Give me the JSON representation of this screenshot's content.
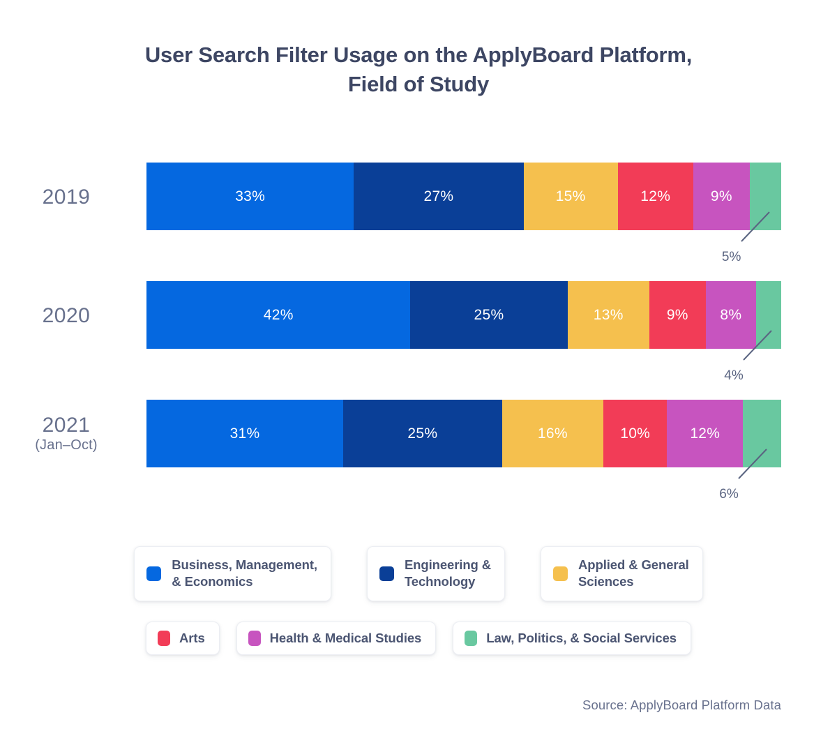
{
  "title": "User Search Filter Usage on the ApplyBoard Platform,\nField of Study",
  "source": "Source: ApplyBoard Platform Data",
  "colors": {
    "business": "#0568e0",
    "engineering": "#0a3f97",
    "sciences": "#f5c04e",
    "arts": "#f23c57",
    "health": "#c754bf",
    "law": "#69c8a0",
    "title_text": "#3d4663",
    "label_text": "#68718d",
    "legend_text": "#4b5572",
    "source_text": "#69728e",
    "card_border": "#eceef3",
    "background": "#ffffff"
  },
  "chart_data": {
    "type": "bar",
    "orientation": "horizontal",
    "stacked": true,
    "normalized_percent": true,
    "title": "User Search Filter Usage on the ApplyBoard Platform, Field of Study",
    "xlabel": "",
    "ylabel": "",
    "xlim": [
      0,
      101
    ],
    "grid": false,
    "legend_position": "bottom",
    "categories": [
      "2019",
      "2020",
      "2021 (Jan–Oct)"
    ],
    "series": [
      {
        "name": "Business, Management, & Economics",
        "color": "#0568e0",
        "values": [
          33,
          42,
          31
        ]
      },
      {
        "name": "Engineering & Technology",
        "color": "#0a3f97",
        "values": [
          27,
          25,
          25
        ]
      },
      {
        "name": "Applied & General Sciences",
        "color": "#f5c04e",
        "values": [
          15,
          13,
          16
        ]
      },
      {
        "name": "Arts",
        "color": "#f23c57",
        "values": [
          12,
          9,
          10
        ]
      },
      {
        "name": "Health & Medical Studies",
        "color": "#c754bf",
        "values": [
          9,
          8,
          12
        ]
      },
      {
        "name": "Law, Politics, & Social Services",
        "color": "#69c8a0",
        "values": [
          5,
          4,
          6
        ]
      }
    ],
    "annotations": [
      {
        "text": "5%",
        "series": "Law, Politics, & Social Services",
        "category": "2019",
        "style": "leader-line-outside"
      },
      {
        "text": "4%",
        "series": "Law, Politics, & Social Services",
        "category": "2020",
        "style": "leader-line-outside"
      },
      {
        "text": "6%",
        "series": "Law, Politics, & Social Services",
        "category": "2021 (Jan–Oct)",
        "style": "leader-line-outside"
      }
    ]
  },
  "rows": [
    {
      "year": "2019",
      "sub": "",
      "segments": [
        {
          "label": "33%",
          "value": 33,
          "color": "#0568e0",
          "inside": true
        },
        {
          "label": "27%",
          "value": 27,
          "color": "#0a3f97",
          "inside": true
        },
        {
          "label": "15%",
          "value": 15,
          "color": "#f5c04e",
          "inside": true
        },
        {
          "label": "12%",
          "value": 12,
          "color": "#f23c57",
          "inside": true
        },
        {
          "label": "9%",
          "value": 9,
          "color": "#c754bf",
          "inside": true
        },
        {
          "label": "5%",
          "value": 5,
          "color": "#69c8a0",
          "inside": false
        }
      ],
      "callout": "5%"
    },
    {
      "year": "2020",
      "sub": "",
      "segments": [
        {
          "label": "42%",
          "value": 42,
          "color": "#0568e0",
          "inside": true
        },
        {
          "label": "25%",
          "value": 25,
          "color": "#0a3f97",
          "inside": true
        },
        {
          "label": "13%",
          "value": 13,
          "color": "#f5c04e",
          "inside": true
        },
        {
          "label": "9%",
          "value": 9,
          "color": "#f23c57",
          "inside": true
        },
        {
          "label": "8%",
          "value": 8,
          "color": "#c754bf",
          "inside": true
        },
        {
          "label": "4%",
          "value": 4,
          "color": "#69c8a0",
          "inside": false
        }
      ],
      "callout": "4%"
    },
    {
      "year": "2021",
      "sub": "(Jan–Oct)",
      "segments": [
        {
          "label": "31%",
          "value": 31,
          "color": "#0568e0",
          "inside": true
        },
        {
          "label": "25%",
          "value": 25,
          "color": "#0a3f97",
          "inside": true
        },
        {
          "label": "16%",
          "value": 16,
          "color": "#f5c04e",
          "inside": true
        },
        {
          "label": "10%",
          "value": 10,
          "color": "#f23c57",
          "inside": true
        },
        {
          "label": "12%",
          "value": 12,
          "color": "#c754bf",
          "inside": true
        },
        {
          "label": "6%",
          "value": 6,
          "color": "#69c8a0",
          "inside": false
        }
      ],
      "callout": "6%"
    }
  ],
  "legend": {
    "row1": [
      {
        "label": "Business, Management,\n& Economics",
        "color": "#0568e0",
        "icon": "color-swatch-icon"
      },
      {
        "label": "Engineering &\nTechnology",
        "color": "#0a3f97",
        "icon": "color-swatch-icon"
      },
      {
        "label": "Applied & General\nSciences",
        "color": "#f5c04e",
        "icon": "color-swatch-icon"
      }
    ],
    "row2": [
      {
        "label": "Arts",
        "color": "#f23c57",
        "icon": "color-swatch-icon"
      },
      {
        "label": "Health & Medical Studies",
        "color": "#c754bf",
        "icon": "color-swatch-icon"
      },
      {
        "label": "Law, Politics, & Social Services",
        "color": "#69c8a0",
        "icon": "color-swatch-icon"
      }
    ]
  }
}
